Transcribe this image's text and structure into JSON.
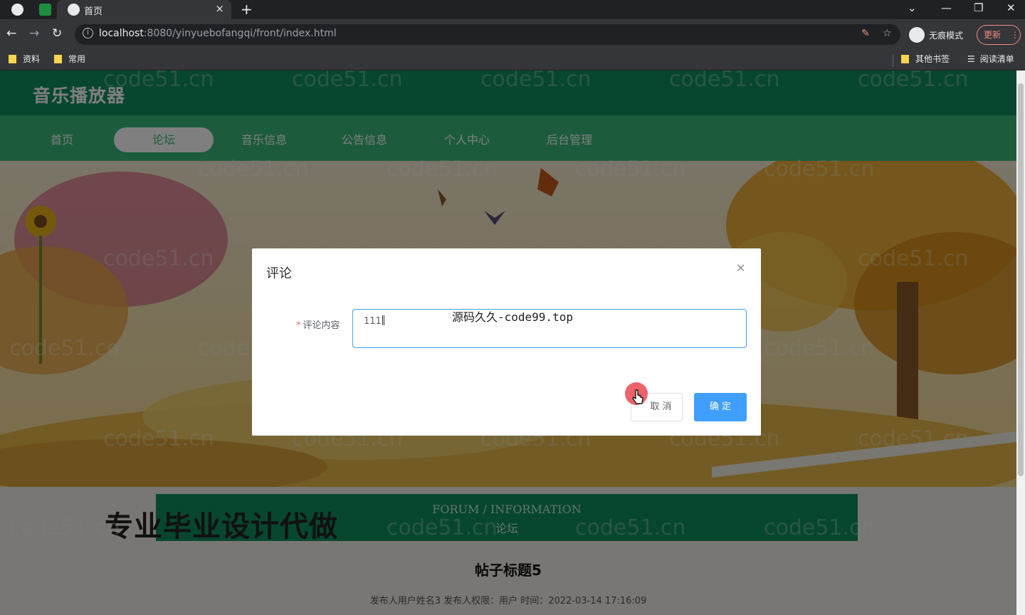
{
  "browser": {
    "tab_title": "首页",
    "url_host": "localhost",
    "url_rest": ":8080/yinyuebofangqi/front/index.html",
    "incognito_label": "无痕模式",
    "update_label": "更新",
    "bookmarks_left": [
      "资料",
      "常用"
    ],
    "bookmarks_right": [
      "其他书签",
      "阅读清单"
    ]
  },
  "site": {
    "brand": "音乐播放器",
    "menu": [
      {
        "label": "首页",
        "active": false
      },
      {
        "label": "论坛",
        "active": true
      },
      {
        "label": "音乐信息",
        "active": false
      },
      {
        "label": "公告信息",
        "active": false
      },
      {
        "label": "个人中心",
        "active": false
      },
      {
        "label": "后台管理",
        "active": false
      }
    ],
    "section_en": "FORUM / INFORMATION",
    "section_cn": "论坛",
    "promo": "专业毕业设计代做",
    "post_title": "帖子标题5",
    "post_meta": "发布人用户姓名3   发布人权限：用户   时间：2022-03-14 17:16:09",
    "watermark": "code51.cn"
  },
  "dialog": {
    "title": "评论",
    "label": "评论内容",
    "required_mark": "*",
    "value": "111",
    "overlay_text": "源码久久-code99.top",
    "cancel": "取 消",
    "confirm": "确 定"
  }
}
